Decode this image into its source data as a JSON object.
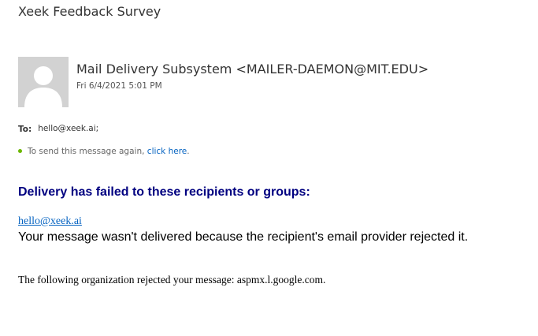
{
  "message": {
    "subject": "Xeek Feedback Survey",
    "sender": "Mail Delivery Subsystem <MAILER-DAEMON@MIT.EDU>",
    "date": "Fri 6/4/2021 5:01 PM",
    "to_label": "To:",
    "to_value": "hello@xeek.ai;",
    "resend_prefix": "To send this message again, ",
    "resend_link": "click here",
    "resend_suffix": ".",
    "avatar_icon": "person-placeholder-icon"
  },
  "body": {
    "heading": "Delivery has failed to these recipients or groups:",
    "recipient": "hello@xeek.ai",
    "not_delivered": "Your message wasn't delivered because the recipient's email provider rejected it.",
    "org_rejected": "The following organization rejected your message: aspmx.l.google.com."
  },
  "colors": {
    "heading": "#000080",
    "link": "#0563c1",
    "status_dot": "#6bb700",
    "avatar_bg": "#d2d2d2"
  }
}
